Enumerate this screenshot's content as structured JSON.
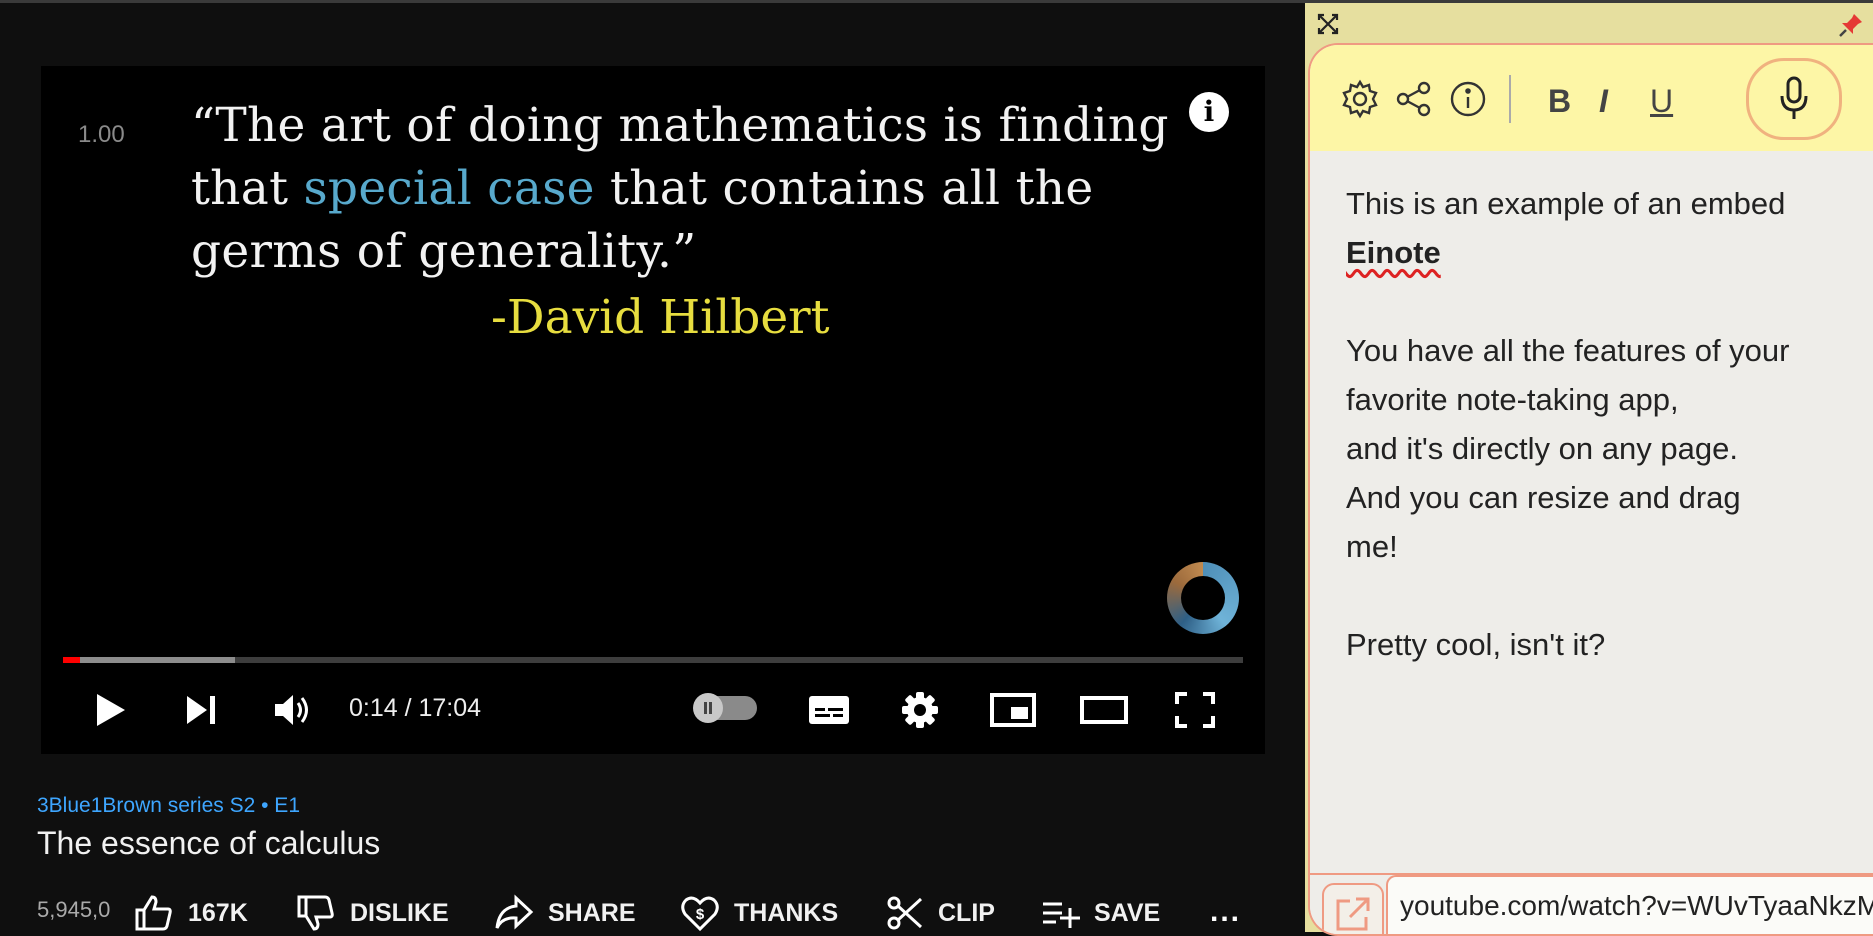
{
  "player": {
    "speed": "1.00",
    "quote_part1": "“The art of doing mathematics is finding that ",
    "quote_highlight": "special case",
    "quote_part2": " that contains all the germs of generality.”",
    "attribution": "-David Hilbert",
    "time": "0:14 / 17:04",
    "progress_played": 0.014,
    "progress_buffered": 0.146
  },
  "video": {
    "series": "3Blue1Brown series  S2 • E1",
    "title": "The essence of calculus",
    "views": "5,945,0",
    "likes": "167K",
    "dislike": "DISLIKE",
    "share": "SHARE",
    "thanks": "THANKS",
    "clip": "CLIP",
    "save": "SAVE",
    "more": "..."
  },
  "note": {
    "toolbar": {
      "bold": "B",
      "italic": "I",
      "underline": "U"
    },
    "line1": "This is an example of an embed",
    "brand": "Einote",
    "line2": "You have all the features of your",
    "line3": "favorite note-taking app,",
    "line4": "and it's directly on any page.",
    "line5": "And you can resize and drag",
    "line6": "me!",
    "line7": "Pretty cool, isn't it?",
    "url": "youtube.com/watch?v=WUvTyaaNkzM"
  },
  "colors": {
    "highlight": "#58a9cc",
    "attribution": "#e7dd3f",
    "link_blue": "#3ea6ff",
    "progress_red": "#ff0000",
    "note_toolbar": "#fdf6a6",
    "note_border": "#ef9a82"
  },
  "icons": [
    "play-icon",
    "next-icon",
    "volume-icon",
    "subtitles-icon",
    "settings-icon",
    "miniplayer-icon",
    "theater-icon",
    "fullscreen-icon",
    "info-icon",
    "like-icon",
    "dislike-icon",
    "share-icon",
    "thanks-icon",
    "clip-icon",
    "save-icon",
    "close-icon",
    "pin-icon",
    "gear-icon",
    "share-nodes-icon",
    "info-circle-icon",
    "mic-icon",
    "external-link-icon"
  ]
}
